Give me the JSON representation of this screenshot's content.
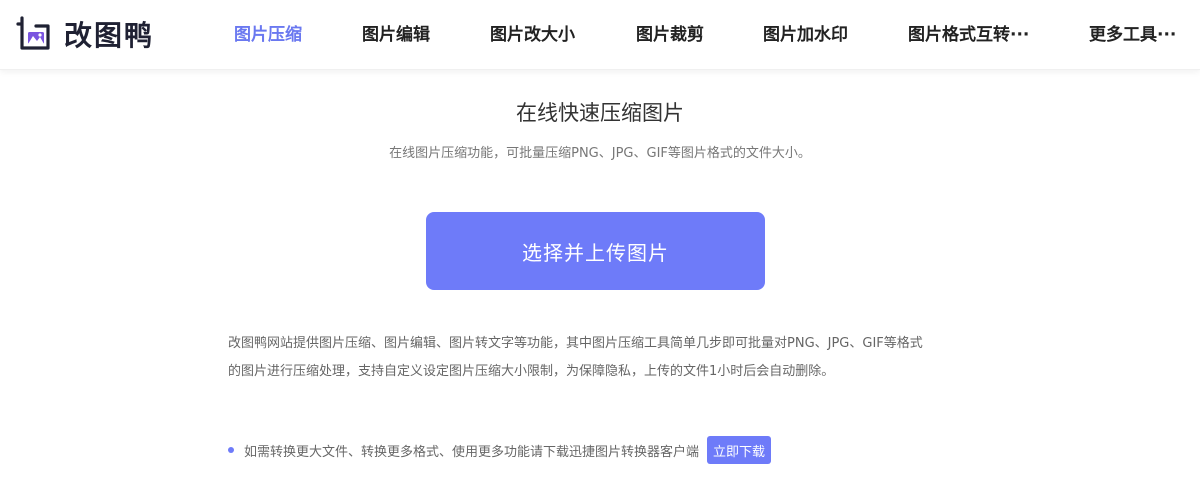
{
  "brand": {
    "name": "改图鸭",
    "logo_color": "#1f2133",
    "accent_color": "#7a55e0"
  },
  "nav": {
    "items": [
      {
        "label": "图片压缩",
        "active": true
      },
      {
        "label": "图片编辑",
        "active": false
      },
      {
        "label": "图片改大小",
        "active": false
      },
      {
        "label": "图片裁剪",
        "active": false
      },
      {
        "label": "图片加水印",
        "active": false
      },
      {
        "label": "图片格式互转···",
        "active": false
      },
      {
        "label": "更多工具···",
        "active": false
      }
    ],
    "active_color": "#6a78f0"
  },
  "main": {
    "title": "在线快速压缩图片",
    "subtitle": "在线图片压缩功能，可批量压缩PNG、JPG、GIF等图片格式的文件大小。",
    "upload_label": "选择并上传图片",
    "primary_color": "#6e7bf9",
    "description_lines": [
      "改图鸭网站提供图片压缩、图片编辑、图片转文字等功能，其中图片压缩工具简单几步即可批量对PNG、JPG、GIF等格式",
      "的图片进行压缩处理，支持自定义设定图片压缩大小限制，为保障隐私，上传的文件1小时后会自动删除。"
    ],
    "tip": {
      "text": "如需转换更大文件、转换更多格式、使用更多功能请下载迅捷图片转换器客户端",
      "button_label": "立即下载"
    }
  }
}
